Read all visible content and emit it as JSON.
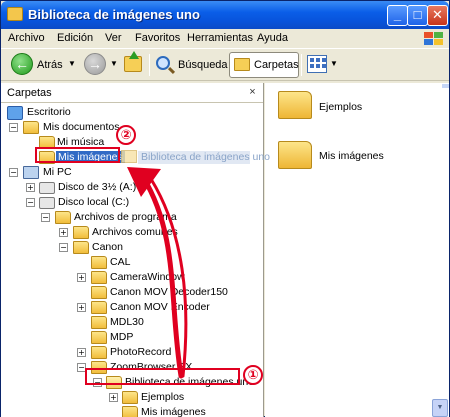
{
  "window": {
    "title": "Biblioteca de imágenes uno",
    "buttons": {
      "minimize": "_",
      "maximize": "□",
      "close": "✕"
    }
  },
  "menu": [
    "Archivo",
    "Edición",
    "Ver",
    "Favoritos",
    "Herramientas",
    "Ayuda"
  ],
  "toolbar": {
    "back_label": "Atrás",
    "search_label": "Búsqueda",
    "folders_label": "Carpetas"
  },
  "folders_pane": {
    "title": "Carpetas",
    "close": "×",
    "tree": [
      {
        "label": "Escritorio",
        "icon": "desktop-icon",
        "expander": ""
      },
      {
        "label": "Mis documentos",
        "icon": "documents-folder-icon",
        "expander": "−"
      },
      {
        "label": "Mi música",
        "icon": "music-folder-icon",
        "expander": ""
      },
      {
        "label": "Mis imágenes",
        "icon": "pictures-folder-icon",
        "expander": "",
        "selected": true
      },
      {
        "label": "Mi PC",
        "icon": "computer-icon",
        "expander": "−"
      },
      {
        "label": "Disco de 3½ (A:)",
        "icon": "floppy-drive-icon",
        "expander": "+"
      },
      {
        "label": "Disco local (C:)",
        "icon": "hard-drive-icon",
        "expander": "−"
      },
      {
        "label": "Archivos de programa",
        "icon": "folder-icon",
        "expander": "−"
      },
      {
        "label": "Archivos comunes",
        "icon": "folder-icon",
        "expander": "+"
      },
      {
        "label": "Canon",
        "icon": "folder-icon",
        "expander": "−"
      },
      {
        "label": "CAL",
        "icon": "folder-icon",
        "expander": ""
      },
      {
        "label": "CameraWindow",
        "icon": "folder-icon",
        "expander": "+"
      },
      {
        "label": "Canon MOV Decoder150",
        "icon": "folder-icon",
        "expander": ""
      },
      {
        "label": "Canon MOV Encoder",
        "icon": "folder-icon",
        "expander": "+"
      },
      {
        "label": "MDL30",
        "icon": "folder-icon",
        "expander": ""
      },
      {
        "label": "MDP",
        "icon": "folder-icon",
        "expander": ""
      },
      {
        "label": "PhotoRecord",
        "icon": "folder-icon",
        "expander": "+"
      },
      {
        "label": "ZoomBrowser EX",
        "icon": "folder-icon",
        "expander": "−"
      },
      {
        "label": "Biblioteca de imágenes uno",
        "icon": "open-folder-icon",
        "expander": "−"
      },
      {
        "label": "Ejemplos",
        "icon": "folder-icon",
        "expander": "+"
      },
      {
        "label": "Mis imágenes",
        "icon": "folder-icon",
        "expander": ""
      }
    ],
    "drag_ghost": "Biblioteca de imágenes uno"
  },
  "content": {
    "items": [
      {
        "label": "Ejemplos",
        "icon": "folder-icon"
      },
      {
        "label": "Mis imágenes",
        "icon": "folder-icon"
      }
    ]
  },
  "annotations": {
    "step1": "①",
    "step2": "②",
    "color": "#e00020"
  }
}
